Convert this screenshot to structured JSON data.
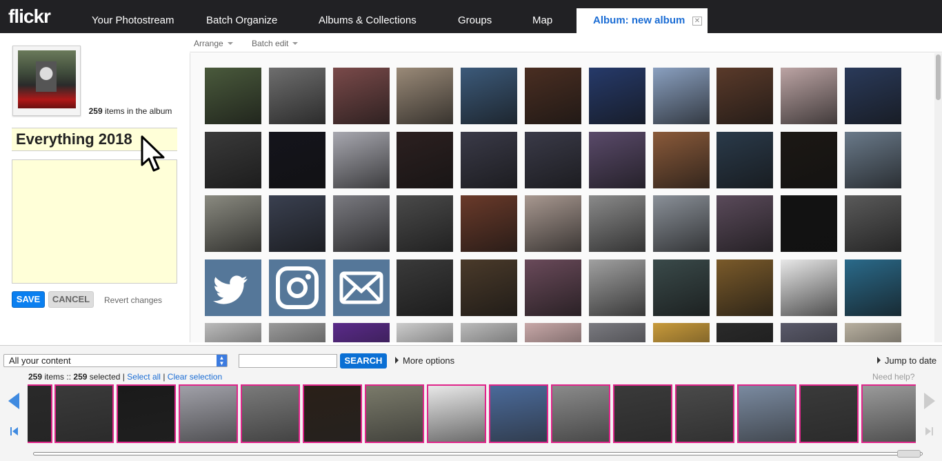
{
  "nav": {
    "logo": "flickr",
    "tabs": [
      "Your Photostream",
      "Batch Organize",
      "Albums & Collections",
      "Groups",
      "Map"
    ],
    "active_tab": "Album: new album",
    "close_glyph": "✕"
  },
  "album": {
    "item_count": "259",
    "items_label": "items in the album",
    "title": "Everything 2018",
    "description": "",
    "save_label": "SAVE",
    "cancel_label": "CANCEL",
    "revert_label": "Revert changes"
  },
  "toolbar": {
    "arrange_label": "Arrange",
    "batch_edit_label": "Batch edit"
  },
  "grid": {
    "tile_colors": [
      [
        "#4a5a3c",
        "#6e6e6e",
        "#7a4a4a",
        "#9a8a78",
        "#3c5a7a",
        "#4a2e22",
        "#263a6a",
        "#8aa0c0",
        "#5a3a2a",
        "#bca4a4",
        "#2a3a5a"
      ],
      [
        "#3a3a3a",
        "#14141c",
        "#a8a8b0",
        "#2c2020",
        "#3a3a48",
        "#3a3a48",
        "#5a4a6a",
        "#8a5a3a",
        "#2a3a4a",
        "#1c1814",
        "#6a7a8a"
      ],
      [
        "#8a8a80",
        "#3a4050",
        "#7a7a80",
        "#4a4a4a",
        "#6a3a2a",
        "#a89890",
        "#8a8a8a",
        "#8a9098",
        "#5a4a5a",
        "#121212",
        "#5a5a5a"
      ],
      [
        "#557799",
        "#557799",
        "#557799",
        "#3a3a3a",
        "#4a3a2a",
        "#6a4a5a",
        "#a0a0a0",
        "#3a4a4a",
        "#7a5a2a",
        "#e8e8e8",
        "#2a6a8a"
      ],
      [
        "#bbbbbb",
        "#9a9a9a",
        "#5a2a8a",
        "#cccccc",
        "#bbbbbb",
        "#c8a8a8",
        "#7a7a80",
        "#c89a3a",
        "#2a2a2a",
        "#5a5a6a",
        "#b8b0a0"
      ]
    ],
    "social_icons": [
      "twitter-icon",
      "instagram-icon",
      "mail-icon"
    ]
  },
  "bottom": {
    "filter_value": "All your content",
    "search_value": "",
    "search_label": "SEARCH",
    "more_options_label": "More options",
    "jump_to_date_label": "Jump to date",
    "status": {
      "count": "259",
      "items_text": "items ::",
      "selected_count": "259",
      "selected_text": "selected |",
      "select_all": "Select all",
      "divider": "|",
      "clear_selection": "Clear selection"
    },
    "need_help": "Need help?",
    "strip_colors": [
      "#2a2a2a",
      "#3a3a3a",
      "#1a1a1a",
      "#a0a0a8",
      "#7a7a7a",
      "#2a2018",
      "#7a7a6a",
      "#e8e8e8",
      "#4a6a9a",
      "#8a8a8a",
      "#3a3a3a",
      "#4a4a4a",
      "#7a8aa0",
      "#3a3a3a",
      "#9a9a9a"
    ]
  },
  "colors": {
    "nav_bg": "#212124",
    "accent_blue": "#1a6cd4",
    "save_blue": "#0a7ff0",
    "selection_pink": "#e0248a",
    "field_yellow": "#ffffd8"
  }
}
